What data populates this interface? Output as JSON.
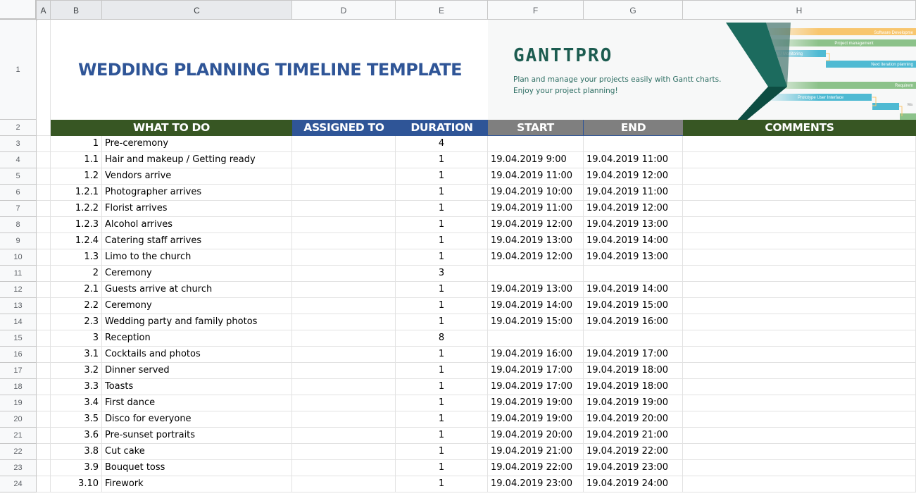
{
  "column_headers": [
    "A",
    "B",
    "C",
    "D",
    "E",
    "F",
    "G",
    "H"
  ],
  "title": "WEDDING PLANNING TIMELINE TEMPLATE",
  "banner": {
    "logo": "GANTTPRO",
    "tagline_1": "Plan and manage your projects easily with Gantt charts.",
    "tagline_2": "Enjoy your project planning!",
    "gantt_bars": [
      "Software Development",
      "Project management",
      "ing / Monitoring",
      "Next iteration planning",
      "Requirem",
      "Prototype User Interface",
      "Ma"
    ]
  },
  "headers": {
    "what_to_do": "WHAT TO DO",
    "assigned_to": "ASSIGNED TO",
    "duration": "DURATION",
    "start": "START",
    "end": "END",
    "comments": "COMMENTS"
  },
  "colors": {
    "title": "#2f5597",
    "header_green": "#375623",
    "header_blue": "#2f5597",
    "header_gray": "#7f7f7f",
    "logo": "#1c5c50"
  },
  "rows": [
    {
      "row": "3",
      "id": "1",
      "task": "Pre-ceremony",
      "assigned": "",
      "duration": "4",
      "start": "",
      "end": "",
      "comments": ""
    },
    {
      "row": "4",
      "id": "1.1",
      "task": "Hair and makeup / Getting ready",
      "assigned": "",
      "duration": "1",
      "start": "19.04.2019 9:00",
      "end": "19.04.2019 11:00",
      "comments": ""
    },
    {
      "row": "5",
      "id": "1.2",
      "task": "Vendors arrive",
      "assigned": "",
      "duration": "1",
      "start": "19.04.2019 11:00",
      "end": "19.04.2019 12:00",
      "comments": ""
    },
    {
      "row": "6",
      "id": "1.2.1",
      "task": "Photographer arrives",
      "assigned": "",
      "duration": "1",
      "start": "19.04.2019 10:00",
      "end": "19.04.2019 11:00",
      "comments": ""
    },
    {
      "row": "7",
      "id": "1.2.2",
      "task": "Florist arrives",
      "assigned": "",
      "duration": "1",
      "start": "19.04.2019 11:00",
      "end": "19.04.2019 12:00",
      "comments": ""
    },
    {
      "row": "8",
      "id": "1.2.3",
      "task": "Alcohol arrives",
      "assigned": "",
      "duration": "1",
      "start": "19.04.2019 12:00",
      "end": "19.04.2019 13:00",
      "comments": ""
    },
    {
      "row": "9",
      "id": "1.2.4",
      "task": "Catering staff arrives",
      "assigned": "",
      "duration": "1",
      "start": "19.04.2019 13:00",
      "end": "19.04.2019 14:00",
      "comments": ""
    },
    {
      "row": "10",
      "id": "1.3",
      "task": "Limo to the church",
      "assigned": "",
      "duration": "1",
      "start": "19.04.2019 12:00",
      "end": "19.04.2019 13:00",
      "comments": ""
    },
    {
      "row": "11",
      "id": "2",
      "task": "Ceremony",
      "assigned": "",
      "duration": "3",
      "start": "",
      "end": "",
      "comments": ""
    },
    {
      "row": "12",
      "id": "2.1",
      "task": "Guests arrive at church",
      "assigned": "",
      "duration": "1",
      "start": "19.04.2019 13:00",
      "end": "19.04.2019 14:00",
      "comments": ""
    },
    {
      "row": "13",
      "id": "2.2",
      "task": "Ceremony",
      "assigned": "",
      "duration": "1",
      "start": "19.04.2019 14:00",
      "end": "19.04.2019 15:00",
      "comments": ""
    },
    {
      "row": "14",
      "id": "2.3",
      "task": "Wedding party and family photos",
      "assigned": "",
      "duration": "1",
      "start": "19.04.2019 15:00",
      "end": "19.04.2019 16:00",
      "comments": ""
    },
    {
      "row": "15",
      "id": "3",
      "task": "Reception",
      "assigned": "",
      "duration": "8",
      "start": "",
      "end": "",
      "comments": ""
    },
    {
      "row": "16",
      "id": "3.1",
      "task": "Cocktails and photos",
      "assigned": "",
      "duration": "1",
      "start": "19.04.2019 16:00",
      "end": "19.04.2019 17:00",
      "comments": ""
    },
    {
      "row": "17",
      "id": "3.2",
      "task": "Dinner served",
      "assigned": "",
      "duration": "1",
      "start": "19.04.2019 17:00",
      "end": "19.04.2019 18:00",
      "comments": ""
    },
    {
      "row": "18",
      "id": "3.3",
      "task": "Toasts",
      "assigned": "",
      "duration": "1",
      "start": "19.04.2019 17:00",
      "end": "19.04.2019 18:00",
      "comments": ""
    },
    {
      "row": "19",
      "id": "3.4",
      "task": "First dance",
      "assigned": "",
      "duration": "1",
      "start": "19.04.2019 19:00",
      "end": "19.04.2019 19:00",
      "comments": ""
    },
    {
      "row": "20",
      "id": "3.5",
      "task": "Disco for everyone",
      "assigned": "",
      "duration": "1",
      "start": "19.04.2019 19:00",
      "end": "19.04.2019 20:00",
      "comments": ""
    },
    {
      "row": "21",
      "id": "3.6",
      "task": "Pre-sunset portraits",
      "assigned": "",
      "duration": "1",
      "start": "19.04.2019 20:00",
      "end": "19.04.2019 21:00",
      "comments": ""
    },
    {
      "row": "22",
      "id": "3.8",
      "task": "Cut cake",
      "assigned": "",
      "duration": "1",
      "start": "19.04.2019 21:00",
      "end": "19.04.2019 22:00",
      "comments": ""
    },
    {
      "row": "23",
      "id": "3.9",
      "task": "Bouquet toss",
      "assigned": "",
      "duration": "1",
      "start": "19.04.2019 22:00",
      "end": "19.04.2019 23:00",
      "comments": ""
    },
    {
      "row": "24",
      "id": "3.10",
      "task": "Firework",
      "assigned": "",
      "duration": "1",
      "start": "19.04.2019 23:00",
      "end": "19.04.2019 24:00",
      "comments": ""
    }
  ]
}
